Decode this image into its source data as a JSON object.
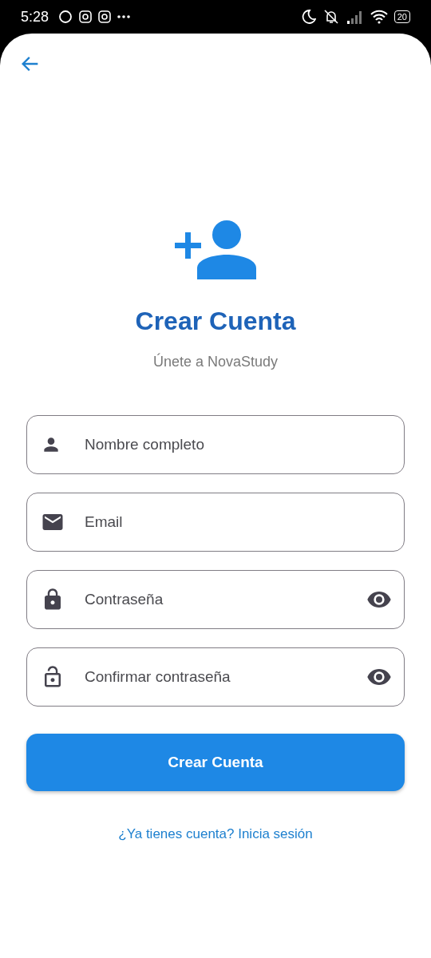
{
  "status_bar": {
    "time": "5:28",
    "battery": "20"
  },
  "title": "Crear Cuenta",
  "subtitle": "Únete a NovaStudy",
  "fields": [
    {
      "kind": "person",
      "placeholder": "Nombre completo",
      "reveal": false
    },
    {
      "kind": "mail",
      "placeholder": "Email",
      "reveal": false
    },
    {
      "kind": "lock",
      "placeholder": "Contraseña",
      "reveal": true
    },
    {
      "kind": "lock-outline",
      "placeholder": "Confirmar contraseña",
      "reveal": true
    }
  ],
  "submit_button": "Crear Cuenta",
  "login_link": "¿Ya tienes cuenta? Inicia sesión"
}
